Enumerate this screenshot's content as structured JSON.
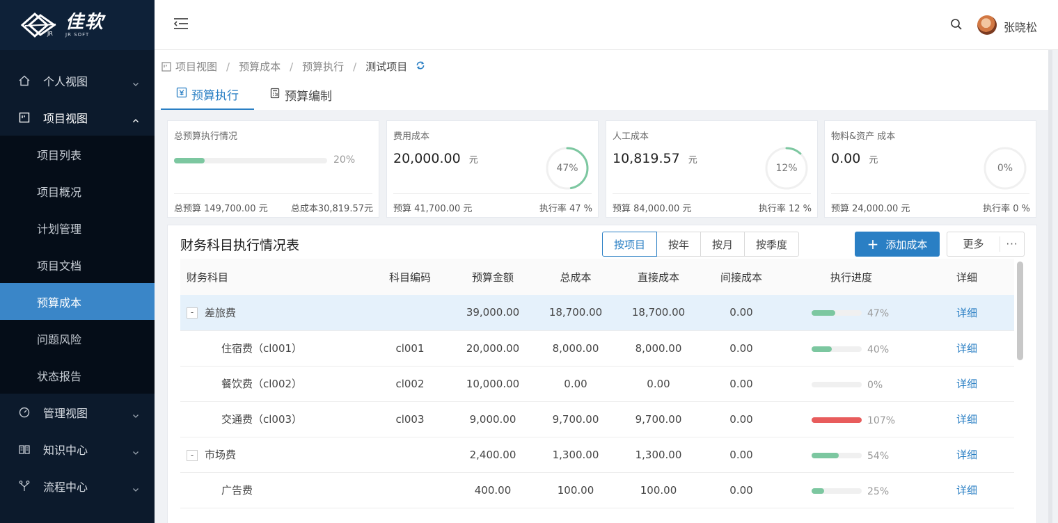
{
  "sidebar": {
    "logo": {
      "brand": "佳软",
      "sub": "JR SOFT",
      "mark_letters": "JR"
    },
    "items": [
      {
        "label": "个人视图",
        "icon": "home-icon",
        "expanded": false
      },
      {
        "label": "项目视图",
        "icon": "board-icon",
        "expanded": true
      },
      {
        "label": "管理视图",
        "icon": "dashboard-icon",
        "expanded": false
      },
      {
        "label": "知识中心",
        "icon": "book-icon",
        "expanded": false
      },
      {
        "label": "流程中心",
        "icon": "flow-icon",
        "expanded": false
      }
    ],
    "sub_items": [
      "项目列表",
      "项目概况",
      "计划管理",
      "项目文档",
      "预算成本",
      "问题风险",
      "状态报告"
    ],
    "selected_sub": "预算成本"
  },
  "header": {
    "username": "张晓松"
  },
  "breadcrumb": [
    "项目视图",
    "预算成本",
    "预算执行",
    "测试项目"
  ],
  "tabs": [
    {
      "label": "预算执行",
      "active": true
    },
    {
      "label": "预算编制",
      "active": false
    }
  ],
  "cards": {
    "total": {
      "title": "总预算执行情况",
      "percent": 20,
      "percent_label": "20%",
      "budget": "总预算 149,700.00 元",
      "cost": "总成本30,819.57元"
    },
    "expense": {
      "title": "费用成本",
      "amount": "20,000.00",
      "unit": "元",
      "percent": 47,
      "percent_label": "47%",
      "budget": "预算 41,700.00 元",
      "rate": "执行率 47 %"
    },
    "labor": {
      "title": "人工成本",
      "amount": "10,819.57",
      "unit": "元",
      "percent": 12,
      "percent_label": "12%",
      "budget": "预算 84,000.00 元",
      "rate": "执行率 12 %"
    },
    "material": {
      "title": "物料&资产 成本",
      "amount": "0.00",
      "unit": "元",
      "percent": 0,
      "percent_label": "0%",
      "budget": "预算 24,000.00 元",
      "rate": "执行率 0 %"
    }
  },
  "table_panel": {
    "title": "财务科目执行情况表",
    "segments": [
      "按项目",
      "按年",
      "按月",
      "按季度"
    ],
    "active_segment": "按项目",
    "add_button": "添加成本",
    "more_button": "更多",
    "more_dots": "···",
    "columns": [
      "财务科目",
      "科目编码",
      "预算金额",
      "总成本",
      "直接成本",
      "间接成本",
      "执行进度",
      "详细"
    ],
    "rows": [
      {
        "name": "差旅费",
        "code": "",
        "budget": "39,000.00",
        "total": "18,700.00",
        "direct": "18,700.00",
        "indirect": "0.00",
        "progress": 47,
        "progress_label": "47%",
        "detail": "详细",
        "level": 0,
        "toggle": "-",
        "highlight": true
      },
      {
        "name": "住宿费（cl001）",
        "code": "cl001",
        "budget": "20,000.00",
        "total": "8,000.00",
        "direct": "8,000.00",
        "indirect": "0.00",
        "progress": 40,
        "progress_label": "40%",
        "detail": "详细",
        "level": 1
      },
      {
        "name": "餐饮费（cl002）",
        "code": "cl002",
        "budget": "10,000.00",
        "total": "0.00",
        "direct": "0.00",
        "indirect": "0.00",
        "progress": 0,
        "progress_label": "0%",
        "detail": "详细",
        "level": 1
      },
      {
        "name": "交通费（cl003）",
        "code": "cl003",
        "budget": "9,000.00",
        "total": "9,700.00",
        "direct": "9,700.00",
        "indirect": "0.00",
        "progress": 107,
        "progress_label": "107%",
        "detail": "详细",
        "level": 1
      },
      {
        "name": "市场费",
        "code": "",
        "budget": "2,400.00",
        "total": "1,300.00",
        "direct": "1,300.00",
        "indirect": "0.00",
        "progress": 54,
        "progress_label": "54%",
        "detail": "详细",
        "level": 0,
        "toggle": "-"
      },
      {
        "name": "广告费",
        "code": "",
        "budget": "400.00",
        "total": "100.00",
        "direct": "100.00",
        "indirect": "0.00",
        "progress": 25,
        "progress_label": "25%",
        "detail": "详细",
        "level": 1
      }
    ]
  },
  "colors": {
    "accent": "#2a7fc4",
    "progress_ok": "#7cc7a0",
    "progress_over": "#e85c5c",
    "sidebar_bg": "#0c1a2c",
    "sidebar_selected": "#3a86c8"
  }
}
